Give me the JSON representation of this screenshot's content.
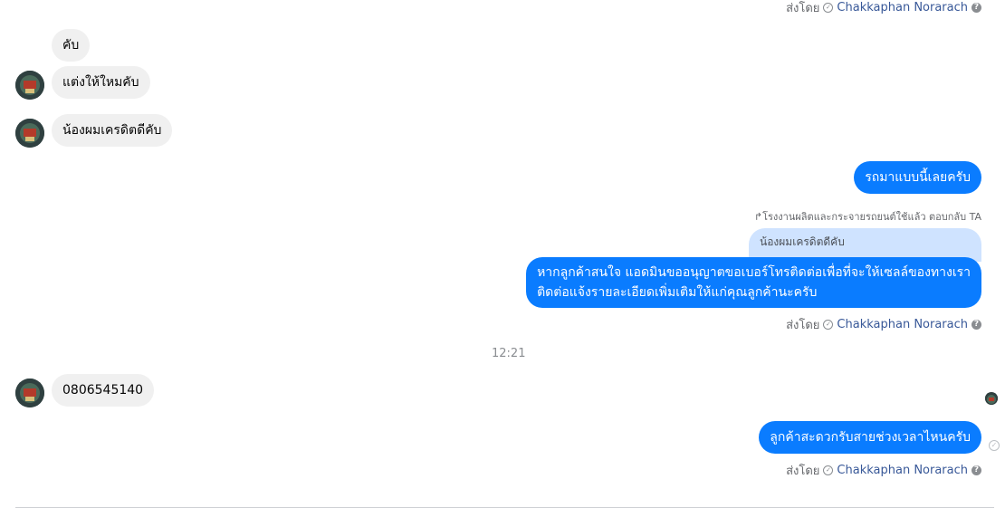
{
  "sent_by_prefix": "ส่งโดย",
  "sender_name": "Chakkaphan Norarach",
  "messages": {
    "in_1": "คับ",
    "in_2": "แต่งให้ใหมคับ",
    "in_3": "น้องผมเครดิตดีคับ",
    "out_1": "รถมาแบบนี้เลยครับ",
    "reply_label": "โรงงานผลิตและกระจายรถยนต์ใช้แล้ว ตอบกลับ TA",
    "quoted_text": "น้องผมเครดิตดีคับ",
    "out_2_line1": "หากลูกค้าสนใจ แอดมินขออนุญาตขอเบอร์โทรติดต่อเพื่อที่จะให้เซลล์ของทางเรา",
    "out_2_line2": "ติดต่อแจ้งรายละเอียดเพิ่มเติมให้แก่คุณลูกค้านะครับ",
    "time": "12:21",
    "in_4": "0806545140",
    "out_3": "ลูกค้าสะดวกรับสายช่วงเวลาไหนครับ"
  },
  "icons": {
    "verified": "verified-badge-icon",
    "help": "question-mark-icon",
    "reply": "reply-arrow-icon",
    "seen": "seen-check-icon"
  },
  "colors": {
    "outgoing_bubble": "#0a7cff",
    "incoming_bubble": "#f0f0f0",
    "quoted_bubble": "#cfe3ff",
    "sender_link": "#385898"
  }
}
